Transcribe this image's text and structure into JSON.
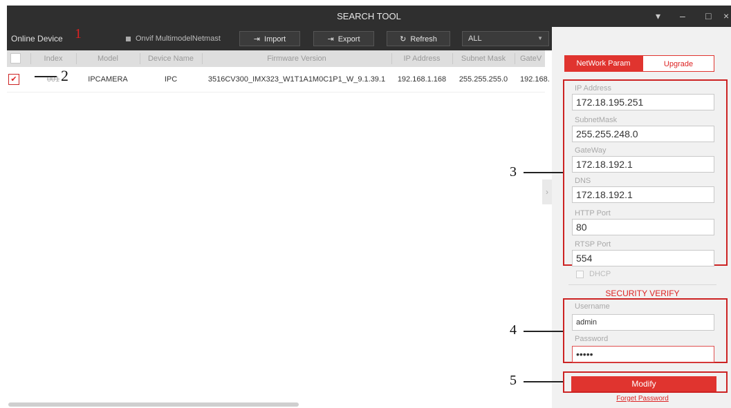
{
  "window": {
    "title": "SEARCH TOOL",
    "controls": [
      "▾",
      "–",
      "□",
      "×"
    ]
  },
  "toolbar": {
    "online_label": "Online Device",
    "onvif_label": "Onvif MultimodelNetmast",
    "import_label": "Import",
    "export_label": "Export",
    "refresh_label": "Refresh",
    "filter_value": "ALL"
  },
  "table": {
    "columns": [
      "Index",
      "Model",
      "Device Name",
      "Firmware Version",
      "IP Address",
      "Subnet Mask",
      "GateV"
    ],
    "rows": [
      {
        "index": "001",
        "model": "IPCAMERA",
        "device_name": "IPC",
        "firmware": "3516CV300_IMX323_W1T1A1M0C1P1_W_9.1.39.1",
        "ip": "192.168.1.168",
        "mask": "255.255.255.0",
        "gateway": "192.168."
      }
    ]
  },
  "panel": {
    "tab_network": "NetWork Param",
    "tab_upgrade": "Upgrade",
    "ip_label": "IP Address",
    "ip_value": "172.18.195.251",
    "mask_label": "SubnetMask",
    "mask_value": "255.255.248.0",
    "gateway_label": "GateWay",
    "gateway_value": "172.18.192.1",
    "dns_label": "DNS",
    "dns_value": "172.18.192.1",
    "http_label": "HTTP Port",
    "http_value": "80",
    "rtsp_label": "RTSP Port",
    "rtsp_value": "554",
    "dhcp_label": "DHCP",
    "security_title": "SECURITY VERIFY",
    "username_label": "Username",
    "username_value": "admin",
    "password_label": "Password",
    "password_value": "•••••",
    "modify_label": "Modify",
    "forgot_label": "Forget Password"
  },
  "annotations": [
    "1",
    "2",
    "3",
    "4",
    "5"
  ],
  "colors": {
    "accent": "#e0342f",
    "titlebar": "#2f2f2f"
  },
  "icons": [
    "import-icon",
    "export-icon",
    "refresh-icon",
    "chevron-down-icon",
    "checkmark-icon",
    "chevron-right-icon"
  ]
}
